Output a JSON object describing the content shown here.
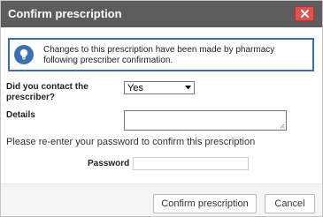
{
  "dialog": {
    "title": "Confirm prescription",
    "close_icon": "close-icon"
  },
  "info": {
    "icon": "lightbulb-icon",
    "message": "Changes to this prescription have been made by pharmacy following prescriber confirmation."
  },
  "form": {
    "contact_label": "Did you contact the prescriber?",
    "contact_value": "Yes",
    "details_label": "Details",
    "details_value": "",
    "reenter_text": "Please re-enter your password to confirm this prescription",
    "password_label": "Password",
    "password_value": ""
  },
  "footer": {
    "confirm_label": "Confirm prescription",
    "cancel_label": "Cancel"
  },
  "colors": {
    "titlebar": "#5d5d5d",
    "close_button": "#d9534f",
    "info_border": "#3a6fb0"
  }
}
